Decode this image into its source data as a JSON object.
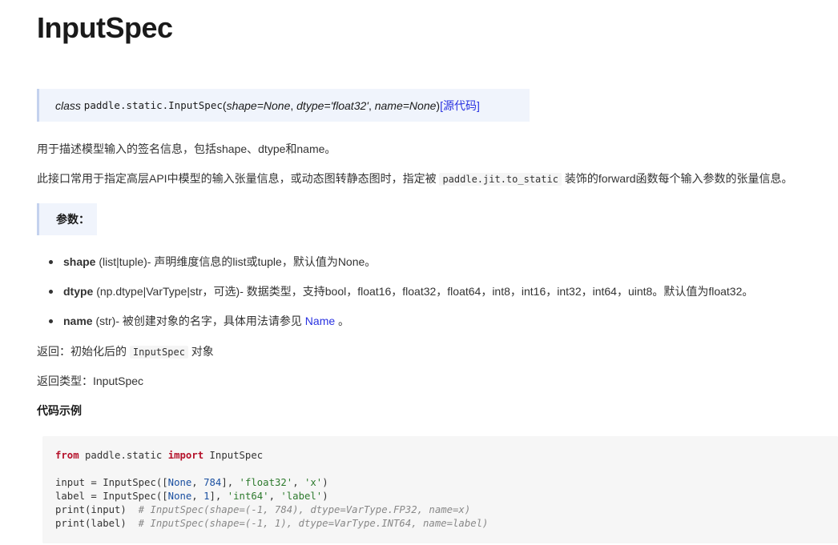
{
  "title": "InputSpec",
  "signature": {
    "keyword": "class",
    "path": "paddle.static.InputSpec",
    "open_paren": "(",
    "param1": "shape=None",
    "sep1": ", ",
    "param2": "dtype='float32'",
    "sep2": ", ",
    "param3": "name=None",
    "close_paren": ")",
    "source_link": "[源代码]"
  },
  "description": {
    "line1": "用于描述模型输入的签名信息，包括shape、dtype和name。",
    "line2_before": "此接口常用于指定高层API中模型的输入张量信息，或动态图转静态图时，指定被 ",
    "line2_code": "paddle.jit.to_static",
    "line2_after": " 装饰的forward函数每个输入参数的张量信息。"
  },
  "params_heading": "参数：",
  "params": [
    {
      "name": "shape",
      "type": " (list|tuple)",
      "desc": "- 声明维度信息的list或tuple，默认值为None。"
    },
    {
      "name": "dtype",
      "type": " (np.dtype|VarType|str，可选)",
      "desc": "- 数据类型，支持bool，float16，float32，float64，int8，int16，int32，int64，uint8。默认值为float32。"
    },
    {
      "name": "name",
      "type": " (str)",
      "desc": "- 被创建对象的名字，具体用法请参见 ",
      "link": "Name",
      "tail": " 。"
    }
  ],
  "returns": {
    "label": "返回：初始化后的 ",
    "code": "InputSpec",
    "tail": " 对象"
  },
  "return_type": "返回类型：InputSpec",
  "example_heading": "代码示例",
  "code": {
    "l1_kw1": "from",
    "l1_mod": " paddle.static ",
    "l1_kw2": "import",
    "l1_name": " InputSpec",
    "l3_a": "input = InputSpec([",
    "l3_none": "None",
    "l3_b": ", ",
    "l3_num": "784",
    "l3_c": "], ",
    "l3_s1": "'float32'",
    "l3_d": ", ",
    "l3_s2": "'x'",
    "l3_e": ")",
    "l4_a": "label = InputSpec([",
    "l4_none": "None",
    "l4_b": ", ",
    "l4_num": "1",
    "l4_c": "], ",
    "l4_s1": "'int64'",
    "l4_d": ", ",
    "l4_s2": "'label'",
    "l4_e": ")",
    "l5_a": "print(input)  ",
    "l5_cm": "# InputSpec(shape=(-1, 784), dtype=VarType.FP32, name=x)",
    "l6_a": "print(label)  ",
    "l6_cm": "# InputSpec(shape=(-1, 1), dtype=VarType.INT64, name=label)"
  },
  "colors": {
    "accent_link": "#2932e1",
    "note_bg": "#f0f4fc",
    "code_bg": "#f6f6f6",
    "keyword": "#b5112a"
  }
}
